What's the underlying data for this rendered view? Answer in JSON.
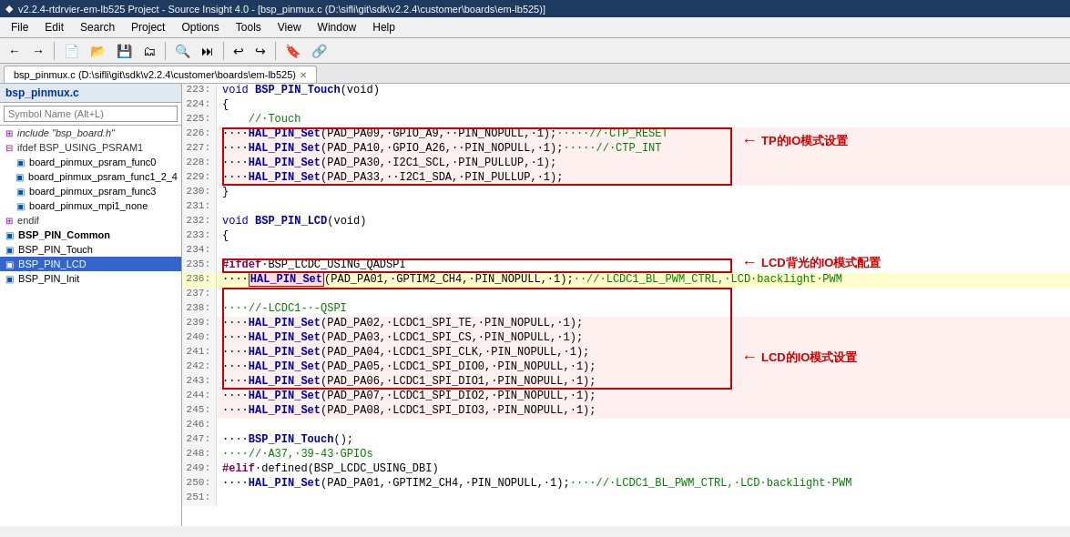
{
  "titleBar": {
    "icon": "◆",
    "text": "v2.2.4-rtdrvier-em-lb525 Project - Source Insight 4.0 - [bsp_pinmux.c (D:\\sifli\\git\\sdk\\v2.2.4\\customer\\boards\\em-lb525)]"
  },
  "menuBar": {
    "items": [
      "File",
      "Edit",
      "Search",
      "Project",
      "Options",
      "Tools",
      "View",
      "Window",
      "Help"
    ]
  },
  "toolbar": {
    "buttons": [
      "←",
      "→",
      "⬛",
      "⬛",
      "⬛",
      "⬛",
      "⬛",
      "⬛",
      "⬛",
      "⬛",
      "⬛",
      "⬛",
      "⬛",
      "⬛",
      "⬛",
      "⬛"
    ]
  },
  "tabBar": {
    "tabs": [
      {
        "label": "bsp_pinmux.c (D:\\sifli\\git\\sdk\\v2.2.4\\customer\\boards\\em-lb525)",
        "active": true
      }
    ]
  },
  "sidebar": {
    "title": "bsp_pinmux.c",
    "searchPlaceholder": "Symbol Name (Alt+L)",
    "items": [
      {
        "indent": 0,
        "icon": "⊞",
        "label": "include \"bsp_board.h\"",
        "type": "include"
      },
      {
        "indent": 0,
        "icon": "⊟",
        "label": "ifdef BSP_USING_PSRAM1",
        "type": "ifdef"
      },
      {
        "indent": 1,
        "icon": "▣",
        "label": "board_pinmux_psram_func0",
        "type": "func"
      },
      {
        "indent": 1,
        "icon": "▣",
        "label": "board_pinmux_psram_func1_2_4",
        "type": "func"
      },
      {
        "indent": 1,
        "icon": "▣",
        "label": "board_pinmux_psram_func3",
        "type": "func"
      },
      {
        "indent": 1,
        "icon": "▣",
        "label": "board_pinmux_mpi1_none",
        "type": "func"
      },
      {
        "indent": 0,
        "icon": "⊞",
        "label": "endif",
        "type": "endif"
      },
      {
        "indent": 0,
        "icon": "▣",
        "label": "BSP_PIN_Common",
        "type": "func",
        "bold": true
      },
      {
        "indent": 0,
        "icon": "▣",
        "label": "BSP_PIN_Touch",
        "type": "func"
      },
      {
        "indent": 0,
        "icon": "▣",
        "label": "BSP_PIN_LCD",
        "type": "func",
        "selected": true
      },
      {
        "indent": 0,
        "icon": "▣",
        "label": "BSP_PIN_Init",
        "type": "func"
      }
    ]
  },
  "code": {
    "lines": [
      {
        "num": 223,
        "content": "void BSP_PIN_Touch(void)",
        "tokens": [
          {
            "t": "kw",
            "v": "void"
          },
          {
            "t": "normal",
            "v": " "
          },
          {
            "t": "fn",
            "v": "BSP_PIN_Touch"
          },
          {
            "t": "normal",
            "v": "(void)"
          }
        ]
      },
      {
        "num": 224,
        "content": "{",
        "tokens": [
          {
            "t": "normal",
            "v": "{"
          }
        ]
      },
      {
        "num": 225,
        "content": "    //·Touch",
        "tokens": [
          {
            "t": "comment",
            "v": "    //·Touch"
          }
        ]
      },
      {
        "num": 226,
        "content": "····HAL_PIN_Set(PAD_PA09,·GPIO_A9,··PIN_NOPULL,·1);·····//·CTP_RESET",
        "highlight": true
      },
      {
        "num": 227,
        "content": "····HAL_PIN_Set(PAD_PA10,·GPIO_A26,··PIN_NOPULL,·1);·····//·CTP_INT",
        "highlight": true
      },
      {
        "num": 228,
        "content": "····HAL_PIN_Set(PAD_PA30,·I2C1_SCL,·PIN_PULLUP,·1);",
        "highlight": true
      },
      {
        "num": 229,
        "content": "····HAL_PIN_Set(PAD_PA33,··I2C1_SDA,·PIN_PULLUP,·1);",
        "highlight": true
      },
      {
        "num": 230,
        "content": "}",
        "tokens": [
          {
            "t": "normal",
            "v": "}"
          }
        ]
      },
      {
        "num": 231,
        "content": ""
      },
      {
        "num": 232,
        "content": "void BSP_PIN_LCD(void)"
      },
      {
        "num": 233,
        "content": "{"
      },
      {
        "num": 234,
        "content": ""
      },
      {
        "num": 235,
        "content": "#ifdef·BSP_LCDC_USING_QADSPI"
      },
      {
        "num": 236,
        "content": "····HAL_PIN_Set(PAD_PA01,·GPTIM2_CH4,·PIN_NOPULL,·1);··//·LCDC1_BL_PWM_CTRL,·LCD·backlight·PWM",
        "highlighted": true
      },
      {
        "num": 237,
        "content": ""
      },
      {
        "num": 238,
        "content": "····//-LCDC1-·-QSPI"
      },
      {
        "num": 239,
        "content": "····HAL_PIN_Set(PAD_PA02,·LCDC1_SPI_TE,·PIN_NOPULL,·1);",
        "boxed": true
      },
      {
        "num": 240,
        "content": "····HAL_PIN_Set(PAD_PA03,·LCDC1_SPI_CS,·PIN_NOPULL,·1);",
        "boxed": true
      },
      {
        "num": 241,
        "content": "····HAL_PIN_Set(PAD_PA04,·LCDC1_SPI_CLK,·PIN_NOPULL,·1);",
        "boxed": true
      },
      {
        "num": 242,
        "content": "····HAL_PIN_Set(PAD_PA05,·LCDC1_SPI_DIO0,·PIN_NOPULL,·1);",
        "boxed": true
      },
      {
        "num": 243,
        "content": "····HAL_PIN_Set(PAD_PA06,·LCDC1_SPI_DIO1,·PIN_NOPULL,·1);",
        "boxed": true
      },
      {
        "num": 244,
        "content": "····HAL_PIN_Set(PAD_PA07,·LCDC1_SPI_DIO2,·PIN_NOPULL,·1);",
        "boxed": true
      },
      {
        "num": 245,
        "content": "····HAL_PIN_Set(PAD_PA08,·LCDC1_SPI_DIO3,·PIN_NOPULL,·1);",
        "boxed": true
      },
      {
        "num": 246,
        "content": ""
      },
      {
        "num": 247,
        "content": "····BSP_PIN_Touch();"
      },
      {
        "num": 248,
        "content": "····//·A37,·39-43·GPIOs"
      },
      {
        "num": 249,
        "content": "#elif·defined(BSP_LCDC_USING_DBI)"
      },
      {
        "num": 250,
        "content": "····HAL_PIN_Set(PAD_PA01,·GPTIM2_CH4,·PIN_NOPULL,·1);····//·LCDC1_BL_PWM_CTRL,·LCD·backlight·PWM"
      },
      {
        "num": 251,
        "content": ""
      }
    ]
  },
  "annotations": {
    "tp_label": "TP的IO模式设置",
    "lcd_backlight_label": "LCD背光的IO模式配置",
    "lcd_io_label": "LCD的IO模式设置"
  }
}
